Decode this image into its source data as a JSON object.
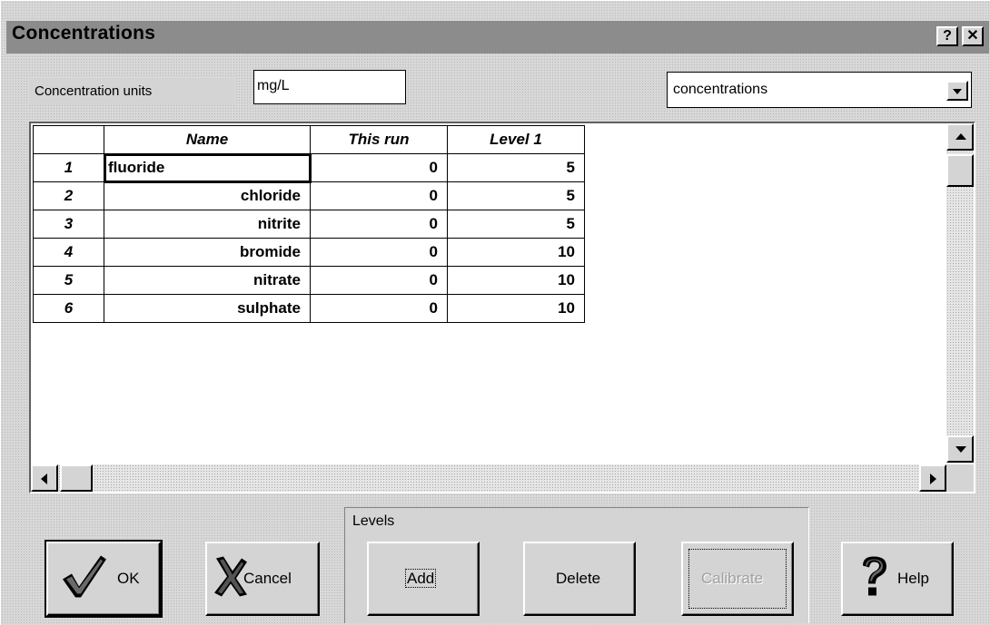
{
  "window": {
    "title": "Concentrations",
    "help_button": "?",
    "close_button": "✕"
  },
  "units": {
    "label": "Concentration units",
    "value": "mg/L"
  },
  "view_select": {
    "selected": "concentrations"
  },
  "grid": {
    "headers": [
      "",
      "Name",
      "This run",
      "Level 1"
    ],
    "rows": [
      {
        "index": "1",
        "name": "fluoride",
        "this_run": "0",
        "level1": "5"
      },
      {
        "index": "2",
        "name": "chloride",
        "this_run": "0",
        "level1": "5"
      },
      {
        "index": "3",
        "name": "nitrite",
        "this_run": "0",
        "level1": "5"
      },
      {
        "index": "4",
        "name": "bromide",
        "this_run": "0",
        "level1": "10"
      },
      {
        "index": "5",
        "name": "nitrate",
        "this_run": "0",
        "level1": "10"
      },
      {
        "index": "6",
        "name": "sulphate",
        "this_run": "0",
        "level1": "10"
      }
    ]
  },
  "buttons": {
    "ok": "OK",
    "cancel": "Cancel",
    "levels_group": "Levels",
    "add": "Add",
    "delete": "Delete",
    "calibrate": "Calibrate",
    "help": "Help"
  },
  "icons": {
    "ok": "checkmark-icon",
    "cancel": "x-icon",
    "help": "question-icon"
  }
}
